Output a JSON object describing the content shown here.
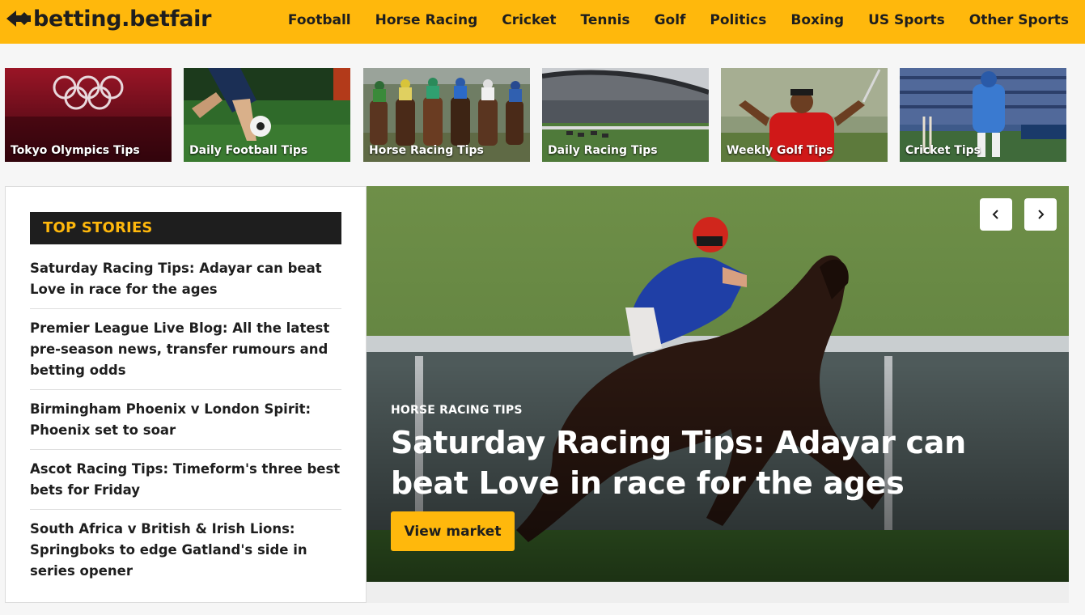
{
  "header": {
    "logo_text": "betting.betfair",
    "logo_icon": "betfair-arrow-logo",
    "brand_color": "#ffb80c",
    "nav": [
      {
        "label": "Football"
      },
      {
        "label": "Horse Racing"
      },
      {
        "label": "Cricket"
      },
      {
        "label": "Tennis"
      },
      {
        "label": "Golf"
      },
      {
        "label": "Politics"
      },
      {
        "label": "Boxing"
      },
      {
        "label": "US Sports"
      },
      {
        "label": "Other Sports"
      }
    ]
  },
  "tiles": [
    {
      "label": "Tokyo Olympics Tips",
      "image": "olympic-rings-photo"
    },
    {
      "label": "Daily Football Tips",
      "image": "football-player-photo"
    },
    {
      "label": "Horse Racing Tips",
      "image": "jockeys-racing-photo"
    },
    {
      "label": "Daily Racing Tips",
      "image": "racecourse-grandstand-photo"
    },
    {
      "label": "Weekly Golf Tips",
      "image": "golfer-celebrating-photo"
    },
    {
      "label": "Cricket Tips",
      "image": "cricket-batsman-photo"
    }
  ],
  "top_stories": {
    "heading": "TOP STORIES",
    "items": [
      {
        "title": "Saturday Racing Tips: Adayar can beat Love in race for the ages"
      },
      {
        "title": "Premier League Live Blog: All the latest pre-season news, transfer rumours and betting odds"
      },
      {
        "title": "Birmingham Phoenix v London Spirit: Phoenix set to soar"
      },
      {
        "title": "Ascot Racing Tips: Timeform's three best bets for Friday"
      },
      {
        "title": "South Africa v British & Irish Lions: Springboks to edge Gatland's side in series opener"
      }
    ]
  },
  "hero": {
    "kicker": "HORSE RACING TIPS",
    "title": "Saturday Racing Tips: Adayar can beat Love in race for the ages",
    "button_label": "View market",
    "prev_icon": "chevron-left-icon",
    "next_icon": "chevron-right-icon",
    "image": "racehorse-and-jockey-photo"
  }
}
